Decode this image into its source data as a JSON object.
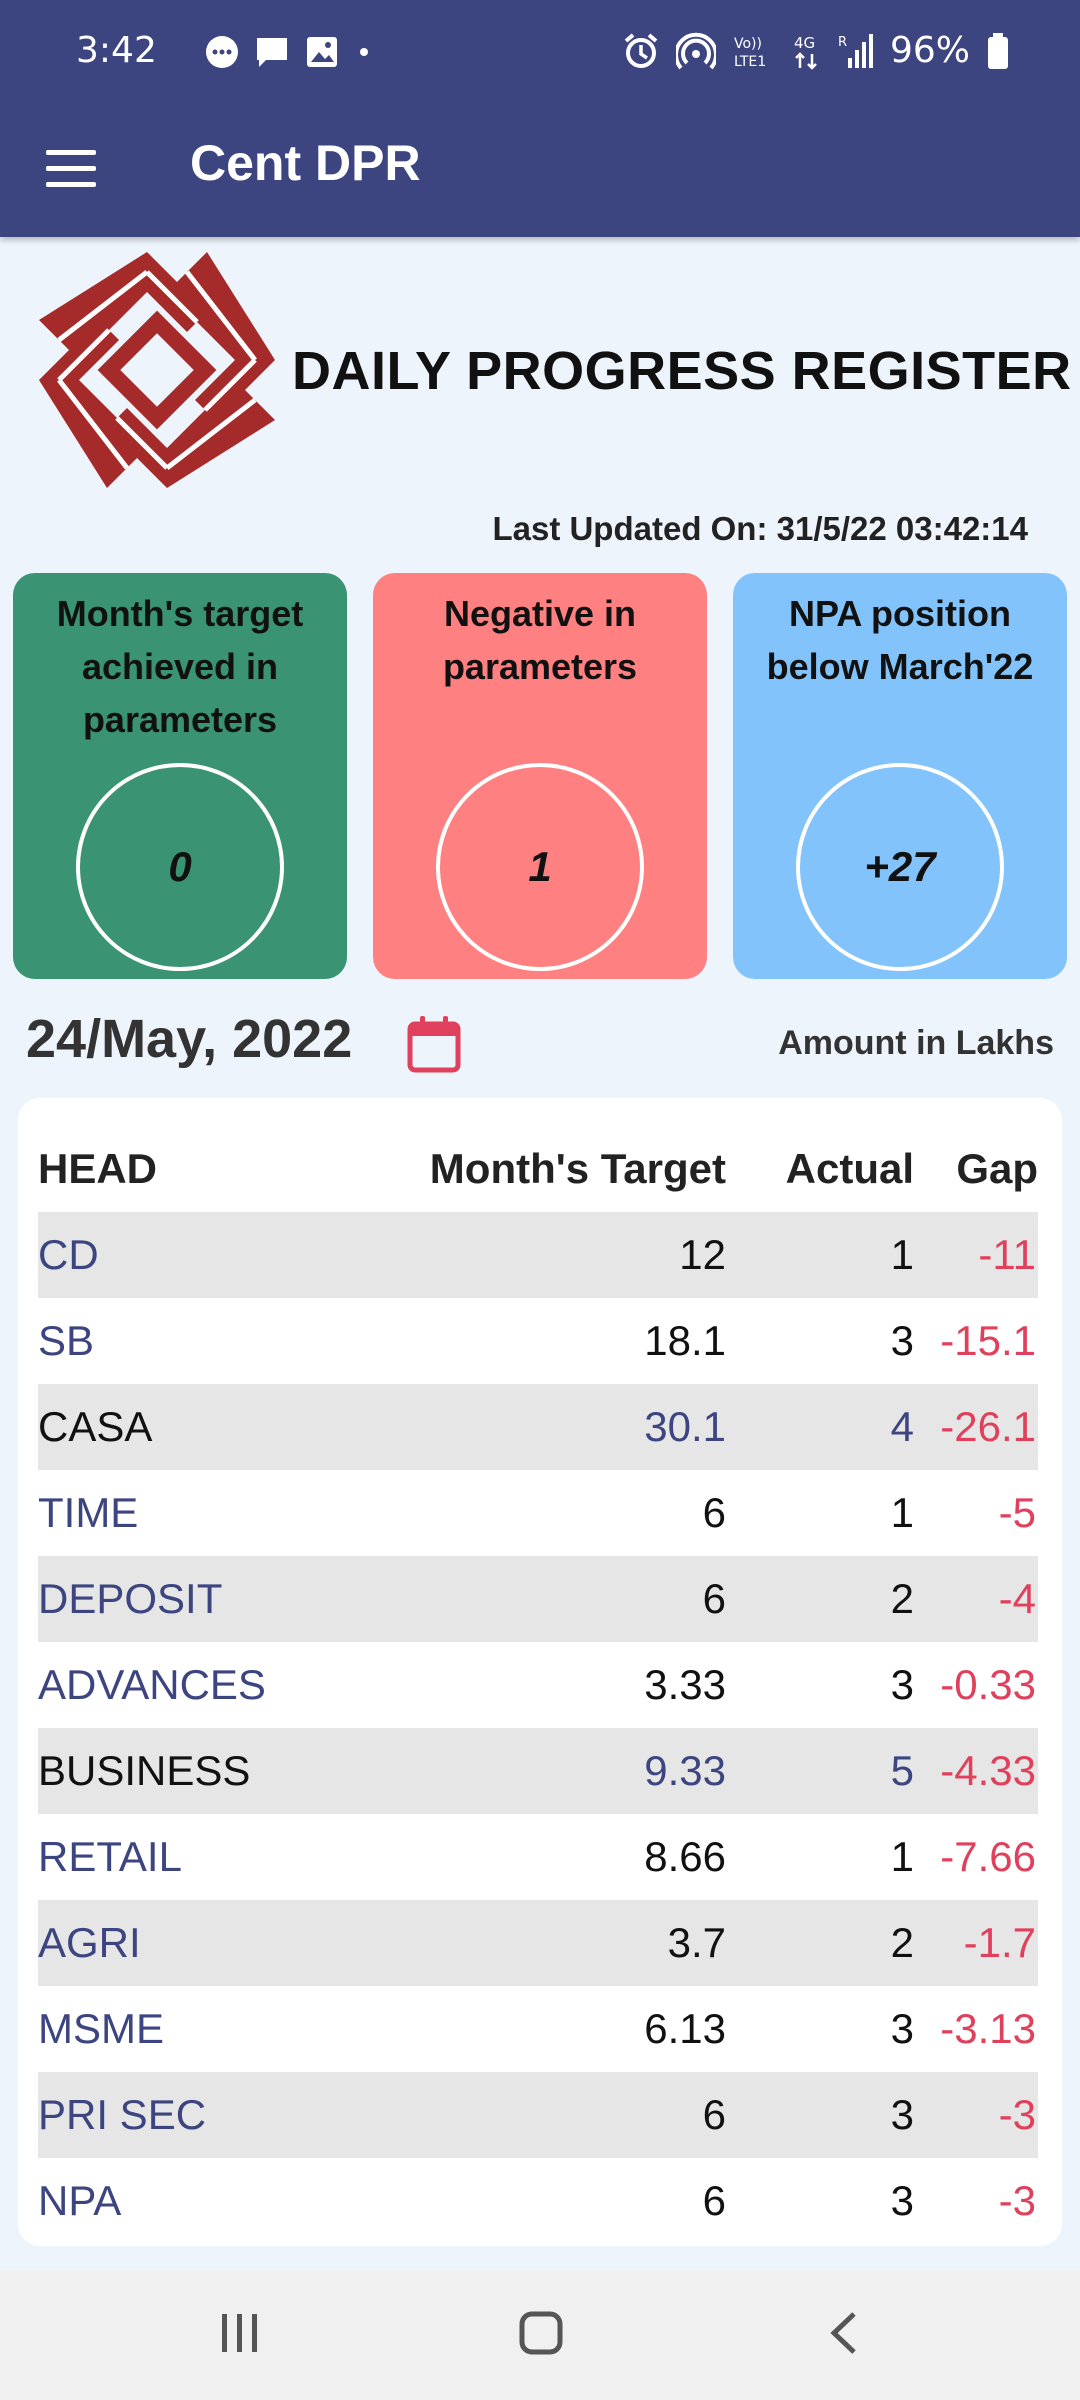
{
  "status_bar": {
    "time": "3:42",
    "battery": "96%",
    "icons": [
      "chat-bubble-icon",
      "message-icon",
      "image-icon",
      "dot-icon",
      "alarm-icon",
      "hotspot-icon",
      "volte-icon",
      "4g-icon",
      "signal-icon",
      "battery-icon"
    ]
  },
  "app_bar": {
    "title": "Cent DPR",
    "menu_icon": "hamburger-menu-icon",
    "color": "#3d4580"
  },
  "header": {
    "title": "DAILY PROGRESS REGISTER",
    "last_updated": "Last Updated On: 31/5/22 03:42:14"
  },
  "cards": [
    {
      "label": "Month's target achieved in parameters",
      "value": "0",
      "color": "#3a9474"
    },
    {
      "label": "Negative in parameters",
      "value": "1",
      "color": "#fe8080"
    },
    {
      "label": "NPA position below March'22",
      "value": "+27",
      "color": "#82c3fc"
    }
  ],
  "date_row": {
    "date": "24/May, 2022",
    "amount_note": "Amount in Lakhs"
  },
  "table": {
    "columns": [
      "HEAD",
      "Month's Target",
      "Actual",
      "Gap"
    ],
    "rows": [
      {
        "head": "CD",
        "target": "12",
        "actual": "1",
        "gap": "-11"
      },
      {
        "head": "SB",
        "target": "18.1",
        "actual": "3",
        "gap": "-15.1"
      },
      {
        "head": "CASA",
        "target": "30.1",
        "actual": "4",
        "gap": "-26.1"
      },
      {
        "head": "TIME",
        "target": "6",
        "actual": "1",
        "gap": "-5"
      },
      {
        "head": "DEPOSIT",
        "target": "6",
        "actual": "2",
        "gap": "-4"
      },
      {
        "head": "ADVANCES",
        "target": "3.33",
        "actual": "3",
        "gap": "-0.33"
      },
      {
        "head": "BUSINESS",
        "target": "9.33",
        "actual": "5",
        "gap": "-4.33"
      },
      {
        "head": "RETAIL",
        "target": "8.66",
        "actual": "1",
        "gap": "-7.66"
      },
      {
        "head": "AGRI",
        "target": "3.7",
        "actual": "2",
        "gap": "-1.7"
      },
      {
        "head": "MSME",
        "target": "6.13",
        "actual": "3",
        "gap": "-3.13"
      },
      {
        "head": "PRI SEC",
        "target": "6",
        "actual": "3",
        "gap": "-3"
      },
      {
        "head": "NPA",
        "target": "6",
        "actual": "3",
        "gap": "-3"
      }
    ]
  },
  "colors": {
    "link": "#3d4580",
    "gap_negative": "#e0405c",
    "logo": "#a52a2a"
  }
}
